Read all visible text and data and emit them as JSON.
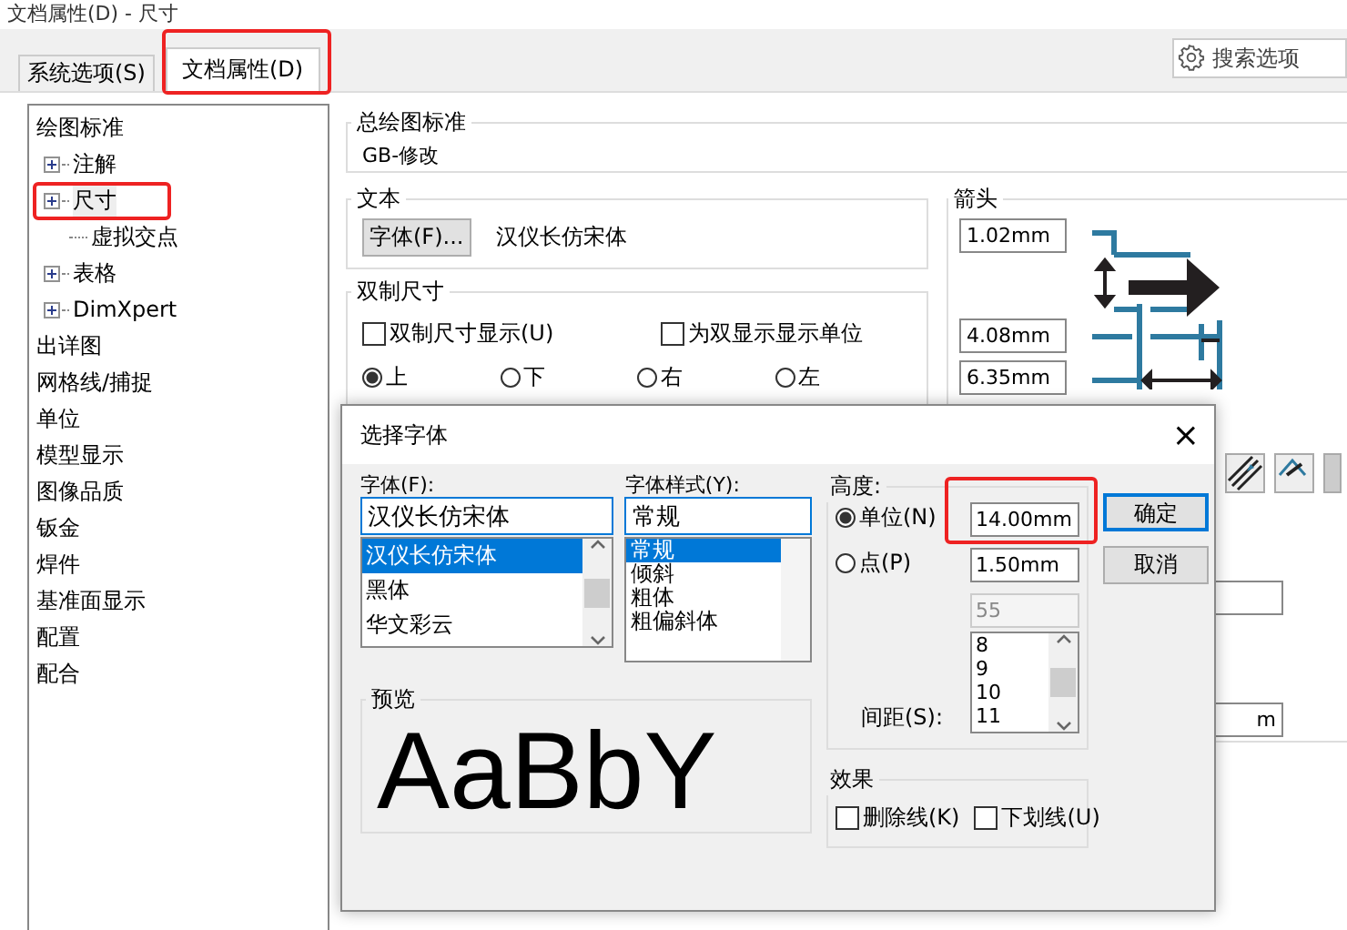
{
  "window": {
    "title": "文档属性(D) - 尺寸"
  },
  "tabs": [
    {
      "label": "系统选项(S)",
      "selected": false,
      "highlighted": false
    },
    {
      "label": "文档属性(D)",
      "selected": true,
      "highlighted": true
    }
  ],
  "search": {
    "placeholder": "搜索选项"
  },
  "tree": [
    {
      "label": "绘图标准",
      "selected": false,
      "children": [
        {
          "label": "注解",
          "kind": "collapsed",
          "selected": false,
          "highlighted": false
        },
        {
          "label": "尺寸",
          "kind": "collapsed",
          "selected": true,
          "highlighted": true
        },
        {
          "label": "虚拟交点",
          "kind": "leaf",
          "selected": false,
          "highlighted": false
        },
        {
          "label": "表格",
          "kind": "collapsed",
          "selected": false,
          "highlighted": false
        },
        {
          "label": "DimXpert",
          "kind": "collapsed",
          "selected": false,
          "highlighted": false
        }
      ]
    },
    {
      "label": "出详图",
      "selected": false
    },
    {
      "label": "网格线/捕捉",
      "selected": false
    },
    {
      "label": "单位",
      "selected": false
    },
    {
      "label": "模型显示",
      "selected": false
    },
    {
      "label": "图像品质",
      "selected": false
    },
    {
      "label": "钣金",
      "selected": false
    },
    {
      "label": "焊件",
      "selected": false
    },
    {
      "label": "基准面显示",
      "selected": false
    },
    {
      "label": "配置",
      "selected": false
    },
    {
      "label": "配合",
      "selected": false
    }
  ],
  "standard": {
    "title": "总绘图标准",
    "value": "GB-修改"
  },
  "text_group": {
    "title": "文本",
    "button": "字体(F)...",
    "font": "汉仪长仿宋体"
  },
  "dual": {
    "title": "双制尺寸",
    "checks": [
      {
        "label": "双制尺寸显示(U)",
        "checked": false
      },
      {
        "label": "为双显示显示单位",
        "checked": false
      }
    ],
    "positions": [
      {
        "label": "上",
        "selected": true
      },
      {
        "label": "下",
        "selected": false
      },
      {
        "label": "右",
        "selected": false
      },
      {
        "label": "左",
        "selected": false
      }
    ]
  },
  "arrows": {
    "title": "箭头",
    "values": [
      "1.02mm",
      "4.08mm",
      "6.35mm"
    ],
    "lower_field": "m"
  },
  "dialog": {
    "title": "选择字体",
    "close": "×",
    "font_label": "字体(F):",
    "font_value": "汉仪长仿宋体",
    "fonts": [
      {
        "label": "汉仪长仿宋体",
        "selected": true
      },
      {
        "label": "黑体",
        "selected": false
      },
      {
        "label": "华文彩云",
        "selected": false
      }
    ],
    "style_label": "字体样式(Y):",
    "style_value": "常规",
    "styles": [
      {
        "label": "常规",
        "selected": true
      },
      {
        "label": "倾斜",
        "selected": false
      },
      {
        "label": "粗体",
        "selected": false
      },
      {
        "label": "粗偏斜体",
        "selected": false
      }
    ],
    "preview_label": "预览",
    "preview": "AaBbY",
    "height_label": "高度:",
    "height_options": [
      {
        "label": "单位(N)",
        "selected": true,
        "value": "14.00mm",
        "highlighted": true
      },
      {
        "label": "点(P)",
        "selected": false,
        "value": "1.50mm",
        "highlighted": false
      }
    ],
    "points_value": "55",
    "points": [
      "8",
      "9",
      "10",
      "11"
    ],
    "spacing_label": "间距(S):",
    "effects_label": "效果",
    "effects": [
      {
        "label": "删除线(K)",
        "checked": false
      },
      {
        "label": "下划线(U)",
        "checked": false
      }
    ],
    "buttons": [
      {
        "label": "确定",
        "focused": true
      },
      {
        "label": "取消",
        "focused": false
      }
    ]
  }
}
